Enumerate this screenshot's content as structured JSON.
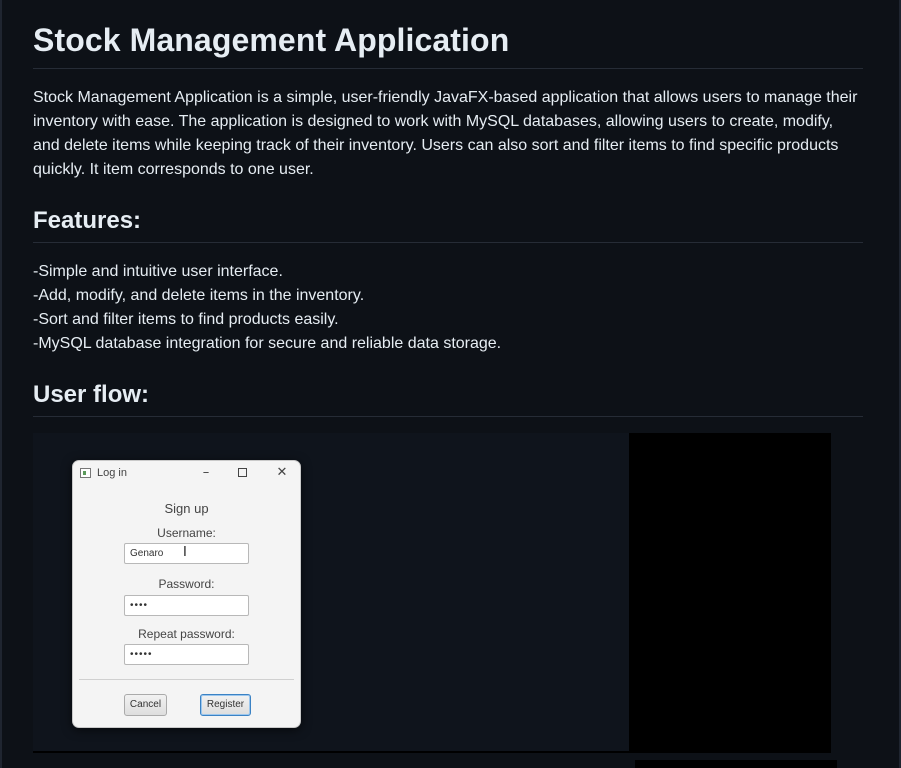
{
  "title": "Stock Management Application",
  "intro": "Stock Management Application is a simple, user-friendly JavaFX-based application that allows users to manage their inventory with ease. The application is designed to work with MySQL databases, allowing users to create, modify, and delete items while keeping track of their inventory. Users can also sort and filter items to find specific products quickly. It item corresponds to one user.",
  "features": {
    "heading": "Features:",
    "items": [
      "-Simple and intuitive user interface.",
      "-Add, modify, and delete items in the inventory.",
      "-Sort and filter items to find products easily.",
      "-MySQL database integration for secure and reliable data storage."
    ]
  },
  "userflow": {
    "heading": "User flow:"
  },
  "dialog": {
    "window_title": "Log in",
    "heading": "Sign up",
    "username_label": "Username:",
    "username_value": "Genaro",
    "password_label": "Password:",
    "password_value": "••••",
    "repeat_label": "Repeat password:",
    "repeat_value": "•••••",
    "cancel_label": "Cancel",
    "register_label": "Register"
  },
  "icons": {
    "minimize": "minimize-icon",
    "maximize": "maximize-icon",
    "close": "close-icon",
    "app": "app-icon",
    "cursor": "text-cursor-icon"
  },
  "colors": {
    "page_background": "#0d1117",
    "text": "#e6edf3",
    "rule": "#262c36",
    "register_focus": "#3b82c4"
  }
}
